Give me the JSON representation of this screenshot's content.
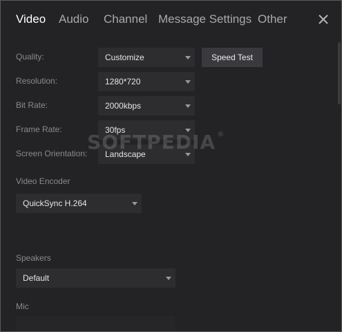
{
  "tabs": [
    "Video",
    "Audio",
    "Channel",
    "Message Settings",
    "Other"
  ],
  "video": {
    "quality_label": "Quality:",
    "quality_value": "Customize",
    "speed_test_label": "Speed Test",
    "resolution_label": "Resolution:",
    "resolution_value": "1280*720",
    "bitrate_label": "Bit Rate:",
    "bitrate_value": "2000kbps",
    "framerate_label": "Frame Rate:",
    "framerate_value": "30fps",
    "orientation_label": "Screen Orientation:",
    "orientation_value": "Landscape",
    "encoder_label": "Video Encoder",
    "encoder_value": "QuickSync H.264"
  },
  "audio": {
    "speakers_label": "Speakers",
    "speakers_value": "Default",
    "mic_label": "Mic"
  },
  "watermark": {
    "text": "SOFTPEDIA",
    "mark": "®"
  },
  "icons": {
    "close": "close-icon",
    "dropdown": "chevron-down-icon"
  },
  "colors": {
    "background": "#232325",
    "field": "#2d2d30",
    "active_tab": "#ffffff",
    "inactive_tab": "#a9a9ad"
  }
}
